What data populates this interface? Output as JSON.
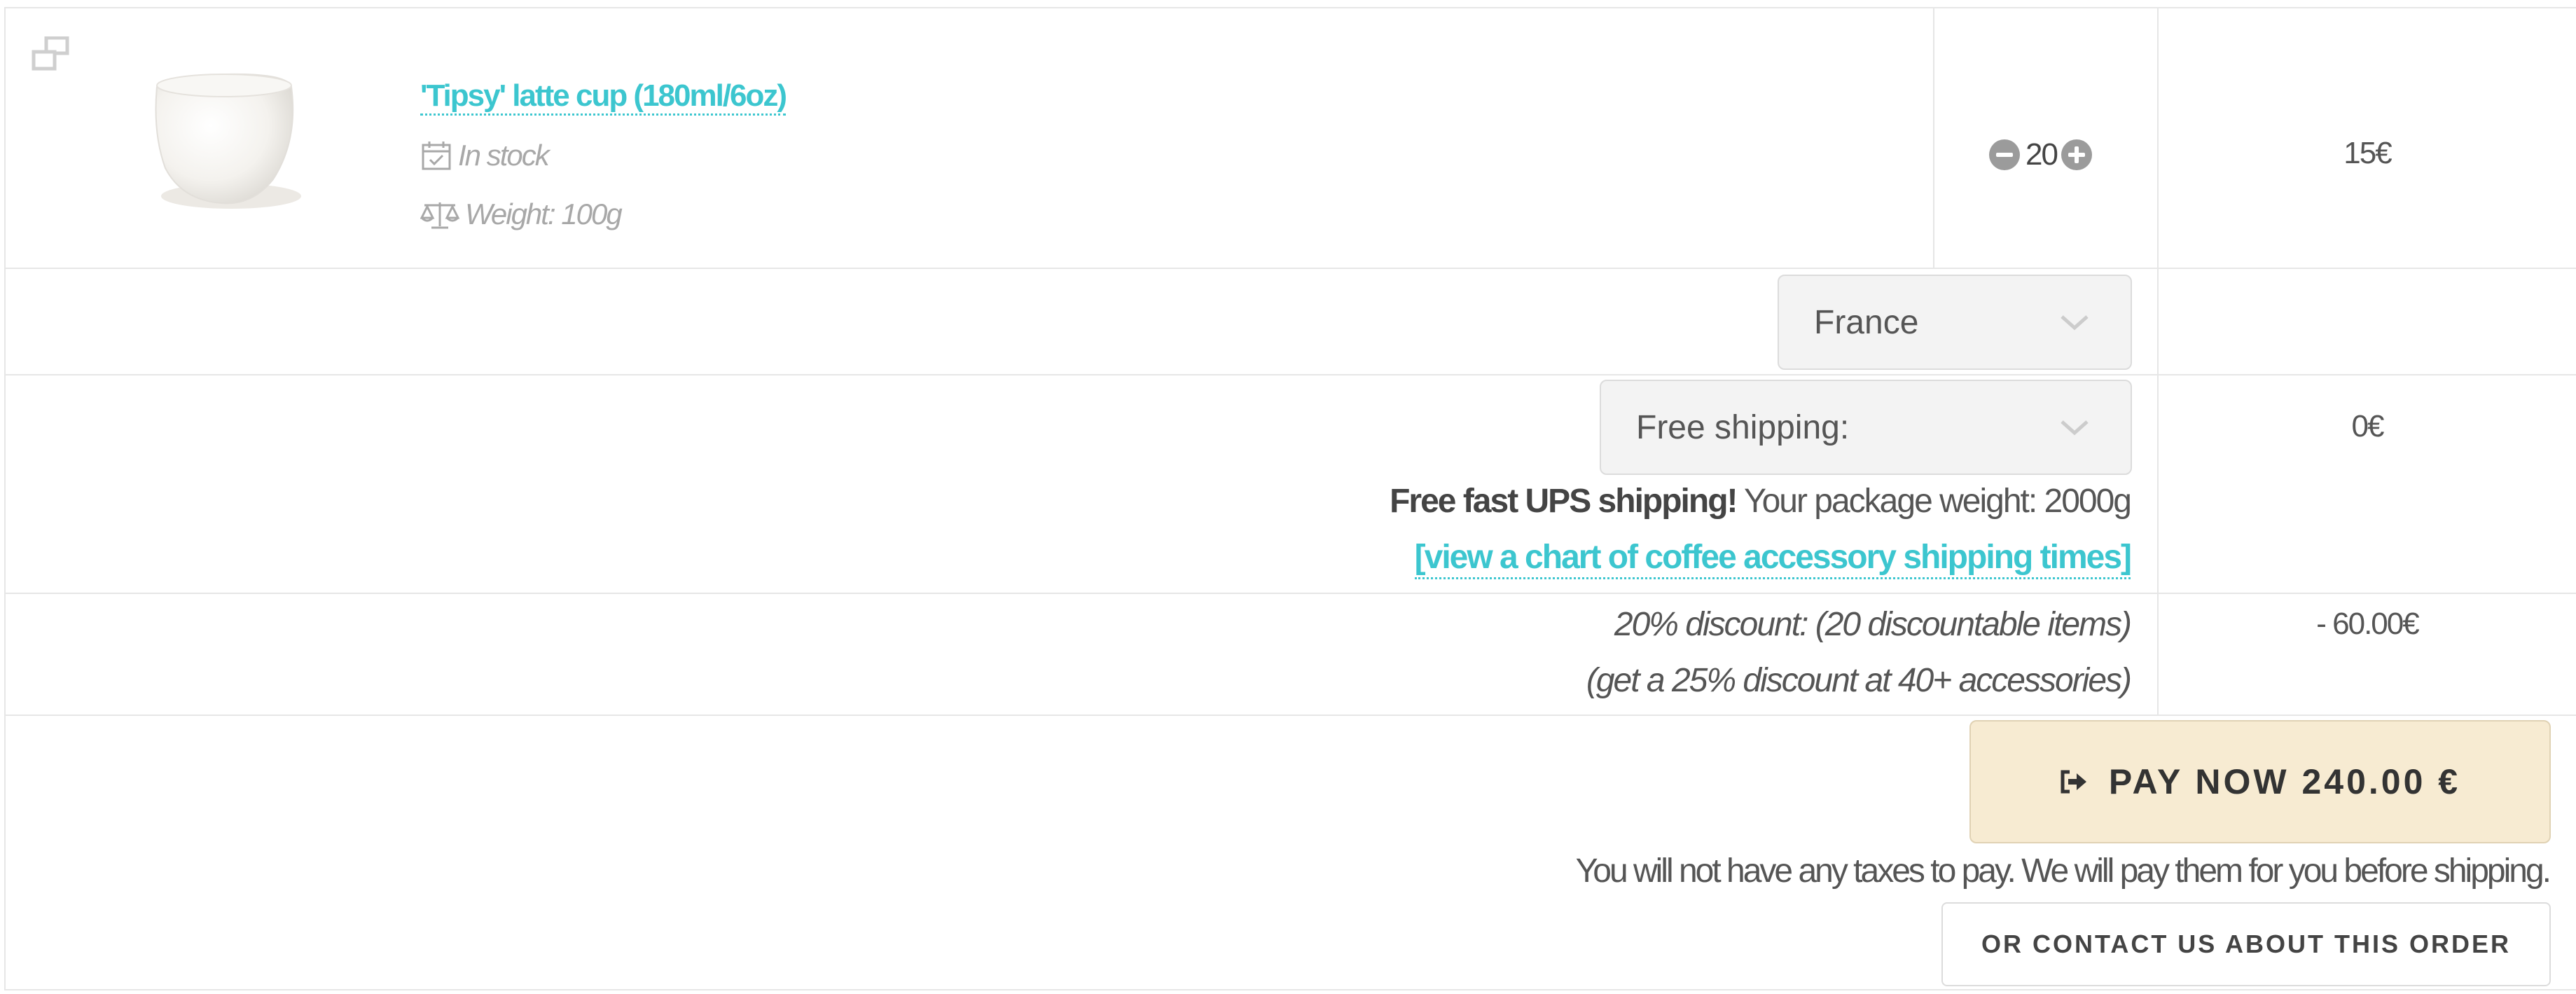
{
  "cart": {
    "product": {
      "name": "'Tipsy' latte cup (180ml/6oz)",
      "stock": "In stock",
      "weight": "Weight: 100g",
      "quantity": "20",
      "price": "15€",
      "image": "white-ceramic-latte-cup"
    },
    "country_select": {
      "value": "France"
    },
    "shipping": {
      "select_value": "Free shipping:",
      "price": "0€",
      "note_bold": "Free fast UPS shipping!",
      "note_rest": " Your package weight: 2000g",
      "chart_link": "[view a chart of coffee accessory shipping times]"
    },
    "discount": {
      "line1": "20% discount: (20 discountable items)",
      "line2": "(get a 25% discount at 40+ accessories)",
      "amount": "- 60.00€"
    },
    "checkout": {
      "pay_label": "PAY NOW 240.00 €",
      "tax_note": "You will not have any taxes to pay. We will pay them for you before shipping.",
      "contact_label": "OR CONTACT US ABOUT THIS ORDER"
    }
  },
  "colors": {
    "accent": "#3cc6cf",
    "pay_button_bg": "#f7ebd2",
    "border": "#e6e6e6",
    "muted_text": "#a8a8a8"
  },
  "icons": {
    "expand": "expand-icon",
    "calendar": "calendar-check-icon",
    "scale": "balance-scale-icon",
    "minus": "minus-circle-icon",
    "plus": "plus-circle-icon",
    "chevron": "chevron-down-icon",
    "sign_out": "sign-out-icon"
  }
}
